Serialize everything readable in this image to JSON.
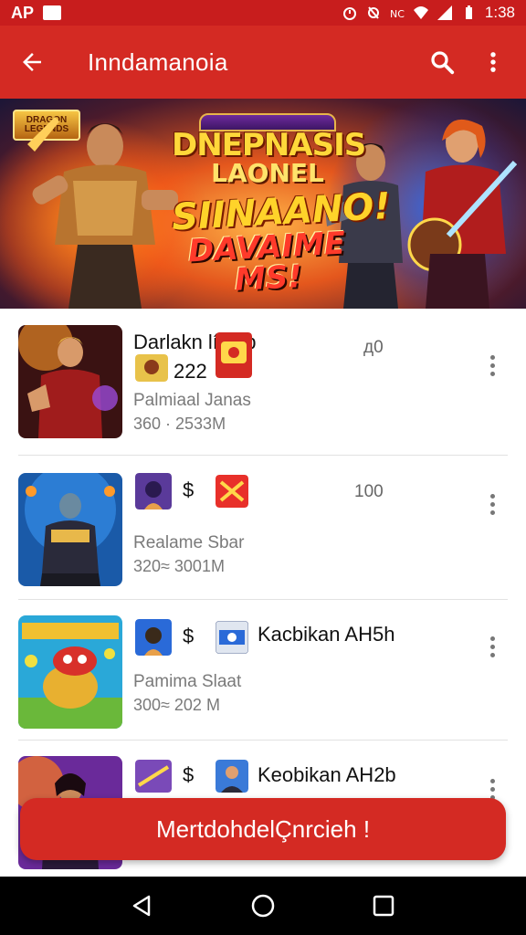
{
  "status_bar": {
    "carrier": "AP",
    "time": "1:38",
    "icons": [
      "notification-icon",
      "alarm-icon",
      "mute-icon",
      "nfc-icon",
      "wifi-icon",
      "signal-icon",
      "battery-icon"
    ]
  },
  "app_bar": {
    "title": "Inndamanoia",
    "back_icon": "arrow-left-icon",
    "actions": [
      "search-icon",
      "more-vert-icon"
    ]
  },
  "banner": {
    "logo_text": "DRAGON LEGENDS",
    "line1": "DNEPNASIS",
    "line2": "LAONEL",
    "line3": "SIINAANO!",
    "line4": "DAVAIME MS!"
  },
  "list": [
    {
      "title": "Darlakn líaiap",
      "price": "222",
      "number": "д0",
      "subtitle": "Palmiaal Janas",
      "meta": "360 · 2533M"
    },
    {
      "title": "",
      "price": "$",
      "number": "100",
      "subtitle": "Realame Sbar",
      "meta": "320≈ 3001M"
    },
    {
      "title": "Kacbikan AH5h",
      "price": "$",
      "number": "",
      "subtitle": "Pamima Slaat",
      "meta": "300≈ 202 M"
    },
    {
      "title": "Keobikan AH2b",
      "price": "$",
      "number": "",
      "subtitle": "",
      "meta": ""
    }
  ],
  "cta": {
    "label": "MertdohdelÇnrcieh !"
  },
  "nav_bar": {
    "buttons": [
      "back-triangle-icon",
      "home-circle-icon",
      "recents-square-icon"
    ]
  },
  "colors": {
    "primary": "#d42a23",
    "status_bar": "#c81d1d",
    "divider": "#e2e2e2",
    "secondary_text": "#7a7a7a"
  }
}
